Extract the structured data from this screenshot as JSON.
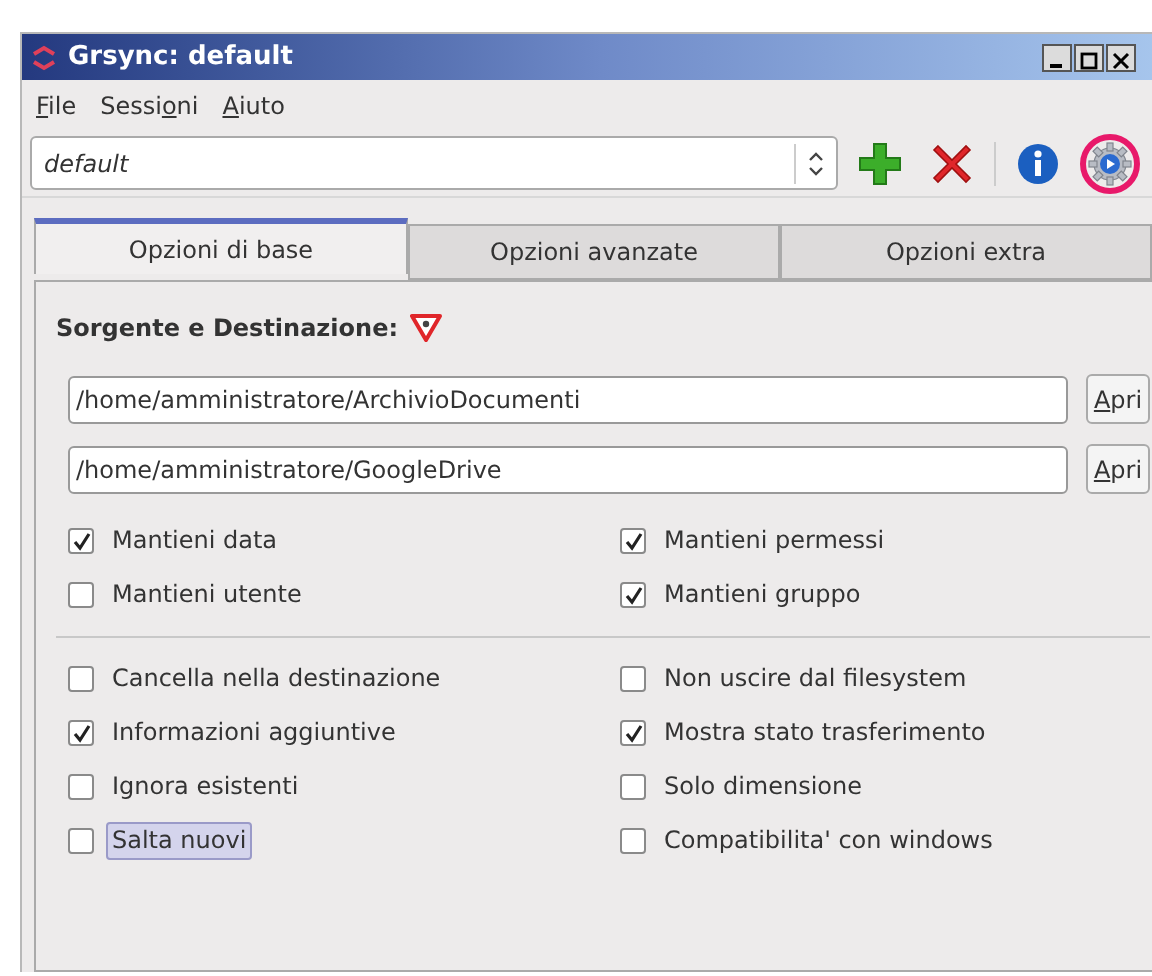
{
  "window": {
    "title": "Grsync: default"
  },
  "menu": [
    {
      "key": "F",
      "after": "ile"
    },
    {
      "before": "Sessi",
      "key": "o",
      "after": "ni"
    },
    {
      "key": "A",
      "after": "iuto"
    }
  ],
  "toolbar": {
    "session": "default",
    "buttons": [
      {
        "kind": "add",
        "highlighted": false
      },
      {
        "kind": "delete",
        "highlighted": false
      },
      {
        "kind": "info",
        "highlighted": false
      },
      {
        "kind": "run",
        "highlighted": true
      }
    ]
  },
  "tabs": [
    {
      "label": "Opzioni di base",
      "selected": true
    },
    {
      "label": "Opzioni avanzate",
      "selected": false
    },
    {
      "label": "Opzioni extra",
      "selected": false
    }
  ],
  "section_label": "Sorgente e Destinazione:",
  "paths": [
    {
      "value": "/home/amministratore/ArchivioDocumenti",
      "button": {
        "key": "A",
        "after": "pri"
      }
    },
    {
      "value": "/home/amministratore/GoogleDrive",
      "button": {
        "key": "A",
        "after": "pri"
      }
    }
  ],
  "option_groups": [
    [
      {
        "label": "Mantieni data",
        "checked": true,
        "focused": false
      },
      {
        "label": "Mantieni permessi",
        "checked": true,
        "focused": false
      },
      {
        "label": "Mantieni utente",
        "checked": false,
        "focused": false
      },
      {
        "label": "Mantieni gruppo",
        "checked": true,
        "focused": false
      }
    ],
    [
      {
        "label": "Cancella nella destinazione",
        "checked": false,
        "focused": false
      },
      {
        "label": "Non uscire dal filesystem",
        "checked": false,
        "focused": false
      },
      {
        "label": "Informazioni aggiuntive",
        "checked": true,
        "focused": false
      },
      {
        "label": "Mostra stato trasferimento",
        "checked": true,
        "focused": false
      },
      {
        "label": "Ignora esistenti",
        "checked": false,
        "focused": false
      },
      {
        "label": "Solo dimensione",
        "checked": false,
        "focused": false
      },
      {
        "label": "Salta nuovi",
        "checked": false,
        "focused": true
      },
      {
        "label": "Compatibilita' con windows",
        "checked": false,
        "focused": false
      }
    ]
  ]
}
